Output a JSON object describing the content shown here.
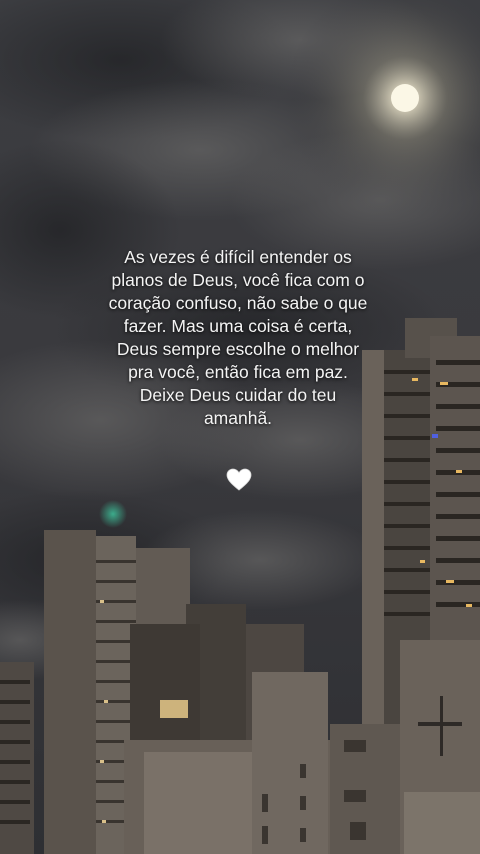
{
  "quote": {
    "lines": [
      "As vezes é difícil entender os",
      "planos de Deus, você fica com o",
      "coração confuso, não sabe o que",
      "fazer. Mas uma coisa é certa,",
      "Deus sempre escolhe o melhor",
      "pra você, então fica em paz.",
      "Deixe Deus cuidar do teu",
      "amanhã."
    ]
  },
  "heart": {
    "icon": "white-heart-icon",
    "color": "#ffffff"
  },
  "scene": {
    "description_icon": "night-sky-cityscape",
    "sky_color": "#3a3b40",
    "moon_color": "#f5f3e6",
    "building_color": "#5b5550",
    "light_color": "#e8b860"
  }
}
